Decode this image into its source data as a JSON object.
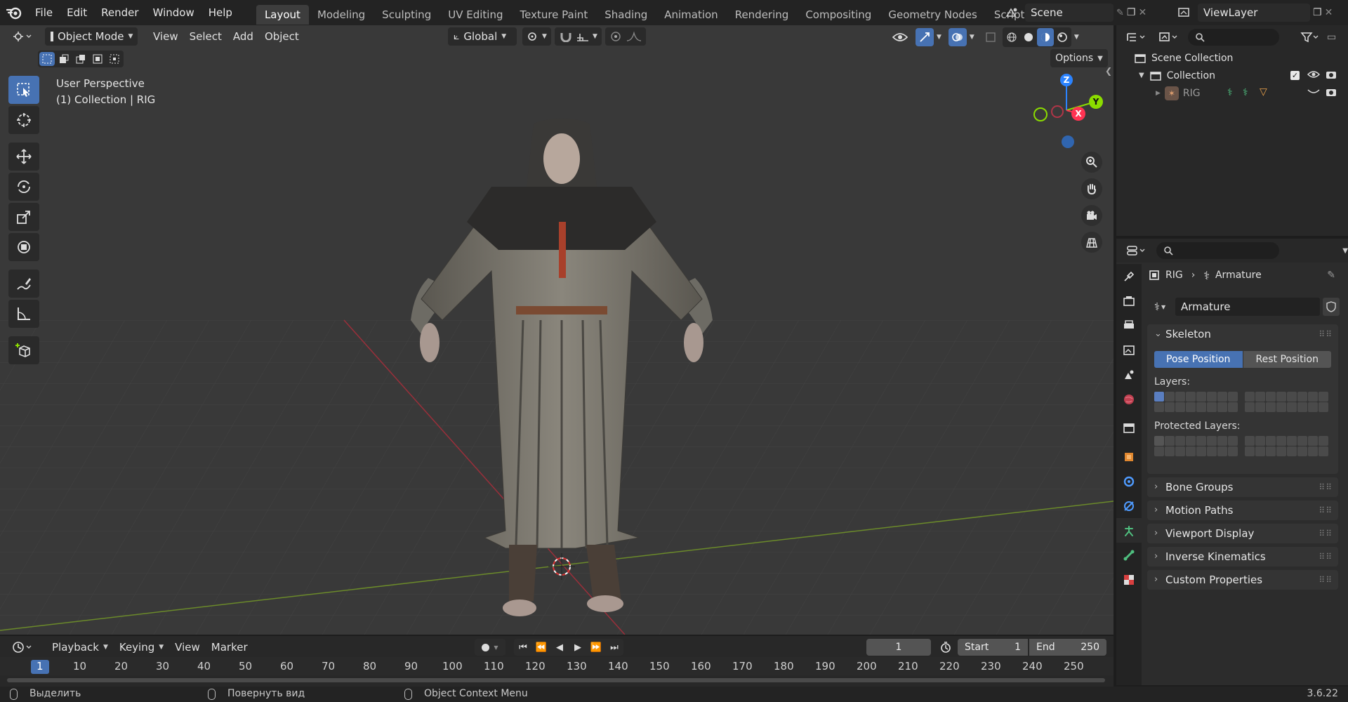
{
  "topbar": {
    "menus": [
      "File",
      "Edit",
      "Render",
      "Window",
      "Help"
    ],
    "workspaces": [
      "Layout",
      "Modeling",
      "Sculpting",
      "UV Editing",
      "Texture Paint",
      "Shading",
      "Animation",
      "Rendering",
      "Compositing",
      "Geometry Nodes",
      "Scripting"
    ],
    "active_workspace": "Layout",
    "add_tab": "+",
    "scene": "Scene",
    "view_layer": "ViewLayer"
  },
  "viewport": {
    "mode": "Object Mode",
    "menus": [
      "View",
      "Select",
      "Add",
      "Object"
    ],
    "orientation": "Global",
    "options": "Options",
    "info_line1": "User Perspective",
    "info_line2": "(1) Collection | RIG",
    "gizmo": {
      "z": "Z",
      "x": "X",
      "y": "Y"
    }
  },
  "outliner": {
    "scene_collection": "Scene Collection",
    "collection": "Collection",
    "object": "RIG"
  },
  "properties": {
    "breadcrumb_object": "RIG",
    "breadcrumb_data": "Armature",
    "data_name": "Armature",
    "skeleton": "Skeleton",
    "pose_position": "Pose Position",
    "rest_position": "Rest Position",
    "layers": "Layers:",
    "protected_layers": "Protected Layers:",
    "panels": [
      "Bone Groups",
      "Motion Paths",
      "Viewport Display",
      "Inverse Kinematics",
      "Custom Properties"
    ]
  },
  "timeline": {
    "menus": [
      "Playback",
      "Keying",
      "View",
      "Marker"
    ],
    "current_frame": "1",
    "start_label": "Start",
    "start_value": "1",
    "end_label": "End",
    "end_value": "250",
    "ticks": [
      "1",
      "10",
      "20",
      "30",
      "40",
      "50",
      "60",
      "70",
      "80",
      "90",
      "100",
      "110",
      "120",
      "130",
      "140",
      "150",
      "160",
      "170",
      "180",
      "190",
      "200",
      "210",
      "220",
      "230",
      "240",
      "250"
    ]
  },
  "statusbar": {
    "select": "Выделить",
    "rotate": "Повернуть вид",
    "context": "Object Context Menu",
    "version": "3.6.22"
  },
  "colors": {
    "accent": "#4772b3",
    "x_axis": "#ff3352",
    "y_axis": "#8bdc00",
    "z_axis": "#2b83ff"
  }
}
